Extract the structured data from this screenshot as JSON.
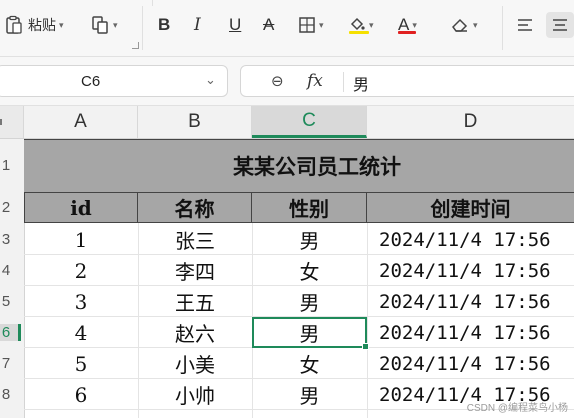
{
  "ribbon": {
    "paste_label": "粘贴",
    "font_color": "#e02020",
    "fill_color": "#f5e000"
  },
  "formula_bar": {
    "name_box": "C6",
    "fx_label": "fx",
    "value": "男"
  },
  "columns": [
    "A",
    "B",
    "C",
    "D"
  ],
  "selected_column": "C",
  "rows": [
    "1",
    "2",
    "3",
    "4",
    "5",
    "6",
    "7",
    "8"
  ],
  "selected_row": "6",
  "sheet": {
    "title": "某某公司员工统计",
    "headers": [
      "id",
      "名称",
      "性别",
      "创建时间"
    ],
    "records": [
      {
        "id": "1",
        "name": "张三",
        "gender": "男",
        "created": "2024/11/4 17:56"
      },
      {
        "id": "2",
        "name": "李四",
        "gender": "女",
        "created": "2024/11/4 17:56"
      },
      {
        "id": "3",
        "name": "王五",
        "gender": "男",
        "created": "2024/11/4 17:56"
      },
      {
        "id": "4",
        "name": "赵六",
        "gender": "男",
        "created": "2024/11/4 17:56"
      },
      {
        "id": "5",
        "name": "小美",
        "gender": "女",
        "created": "2024/11/4 17:56"
      },
      {
        "id": "6",
        "name": "小帅",
        "gender": "男",
        "created": "2024/11/4 17:56"
      }
    ]
  },
  "watermark": "CSDN @编程菜鸟小杨",
  "colors": {
    "accent": "#1e8a5a",
    "header_fill": "#a6a6a6"
  }
}
